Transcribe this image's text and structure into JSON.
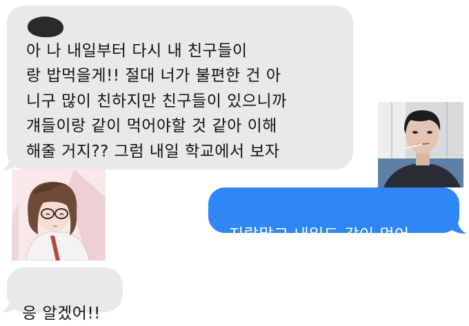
{
  "messages": [
    {
      "sender": "friend",
      "text": "아 나 내일부터 다시 내 친구들이\n랑 밥먹을게!! 절대 너가 불편한 건 아\n니구 많이 친하지만 친구들이 있으니까\n걔들이랑 같이 먹어야할 것 같아 이해\n해줄 거지?? 그럼 내일 학교에서 보자\nㅎㅎ"
    },
    {
      "sender": "me",
      "text": "지랄말고 내일도 같이 먹어"
    },
    {
      "sender": "friend",
      "text": "응 알겠어!!"
    }
  ],
  "colors": {
    "received_bubble": "#e9e9eb",
    "sent_bubble": "#2f86f6",
    "received_text": "#111111",
    "sent_text": "#ffffff"
  },
  "avatars": {
    "right": "photo-avatar-young-man",
    "left": "illustrated-avatar-girl-with-glasses"
  }
}
